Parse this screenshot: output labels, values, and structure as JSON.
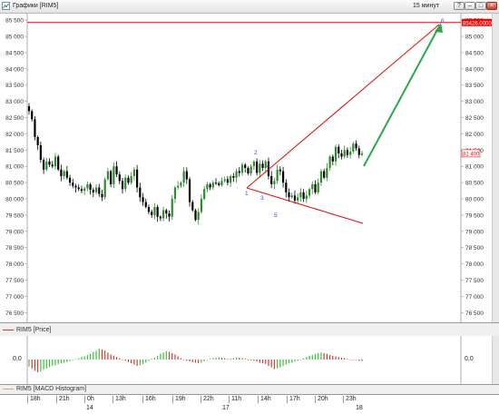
{
  "window": {
    "title": "Графики [RIM5]",
    "timeframe": "15 минут",
    "buttons": [
      "?",
      "–",
      "□",
      "×"
    ]
  },
  "legend": {
    "price": "RIM5 [Price]",
    "macd": "RIM5 [MACD Histogram]"
  },
  "price_labels": {
    "resistance": "85426.0000",
    "current": "81 400"
  },
  "macd_zero_label": "0,0",
  "time_axis": {
    "hours": [
      "18h",
      "21h",
      "0h",
      "13h",
      "16h",
      "19h",
      "22h",
      "11h",
      "14h",
      "17h",
      "20h",
      "23h"
    ],
    "days": [
      "14",
      "17",
      "18"
    ]
  },
  "wave_labels": [
    "1",
    "2",
    "3",
    "4",
    "5",
    "6"
  ],
  "colors": {
    "bull": "#2e8b2e",
    "bear": "#000000",
    "trendline": "#e31010",
    "arrow": "#2aa84a",
    "wave_label": "#3a4fd0",
    "resistance": "#ff0000"
  },
  "chart_data": {
    "type": "candlestick",
    "y_ticks": [
      "85 500",
      "85 000",
      "84 500",
      "84 000",
      "83 500",
      "83 000",
      "82 500",
      "82 000",
      "81 500",
      "81 000",
      "80 500",
      "80 000",
      "79 500",
      "79 000",
      "78 500",
      "78 000",
      "77 500",
      "77 000",
      "76 500"
    ],
    "ylim": [
      76200,
      85700
    ],
    "resistance_level": 85426,
    "current_price": 81400,
    "closes": [
      82700,
      82450,
      81900,
      81650,
      81200,
      80900,
      81150,
      81050,
      81000,
      81300,
      80900,
      80700,
      80850,
      80650,
      80500,
      80400,
      80350,
      80300,
      80250,
      80320,
      80450,
      80280,
      80200,
      80350,
      80150,
      80050,
      80600,
      80850,
      80450,
      81000,
      80750,
      80550,
      80300,
      80650,
      80500,
      80700,
      80900,
      80350,
      80050,
      79900,
      79750,
      79600,
      79500,
      79750,
      79450,
      79400,
      79650,
      79550,
      79450,
      80000,
      80350,
      80400,
      80500,
      80850,
      80600,
      79900,
      79650,
      79350,
      79600,
      80000,
      80300,
      80450,
      80350,
      80500,
      80480,
      80420,
      80550,
      80600,
      80500,
      80700,
      80650,
      80850,
      80800,
      81050,
      80950,
      80780,
      81000,
      81150,
      80800,
      81080,
      80950,
      81150,
      80700,
      80450,
      80550,
      80900,
      80850,
      80500,
      80200,
      80050,
      80100,
      79950,
      80050,
      80200,
      80000,
      80100,
      80300,
      80450,
      80200,
      80500,
      80850,
      80650,
      80950,
      81300,
      81150,
      81600,
      81400,
      81300,
      81500,
      81350,
      81450,
      81700,
      81550,
      81350,
      81400
    ],
    "macd": [
      -0.55,
      -0.7,
      -0.9,
      -1.0,
      -0.95,
      -0.8,
      -0.7,
      -0.6,
      -0.5,
      -0.45,
      -0.35,
      -0.3,
      -0.25,
      -0.2,
      -0.1,
      -0.05,
      0.05,
      0.1,
      0.2,
      0.25,
      0.35,
      0.45,
      0.6,
      0.7,
      0.85,
      0.8,
      0.7,
      0.55,
      0.4,
      0.3,
      0.2,
      0.1,
      0.0,
      -0.1,
      -0.2,
      -0.3,
      -0.4,
      -0.5,
      -0.45,
      -0.35,
      -0.25,
      -0.1,
      0.05,
      0.15,
      0.3,
      0.45,
      0.55,
      0.65,
      0.6,
      0.5,
      0.4,
      0.25,
      0.1,
      0.0,
      -0.1,
      -0.15,
      -0.2,
      -0.25,
      -0.3,
      -0.25,
      -0.15,
      -0.05,
      0.05,
      0.12,
      0.15,
      0.18,
      0.15,
      0.1,
      0.05,
      0.08,
      0.12,
      0.18,
      0.15,
      0.1,
      0.05,
      0.0,
      -0.05,
      -0.1,
      -0.15,
      -0.25,
      -0.3,
      -0.35,
      -0.5,
      -0.6,
      -0.75,
      -0.7,
      -0.6,
      -0.5,
      -0.4,
      -0.3,
      -0.25,
      -0.15,
      -0.1,
      0.0,
      0.1,
      0.2,
      0.3,
      0.35,
      0.45,
      0.5,
      0.55,
      0.5,
      0.45,
      0.35,
      0.3,
      0.25,
      0.2,
      0.15,
      0.1,
      0.05,
      0.0,
      -0.05,
      -0.05,
      -0.1,
      -0.12
    ]
  }
}
